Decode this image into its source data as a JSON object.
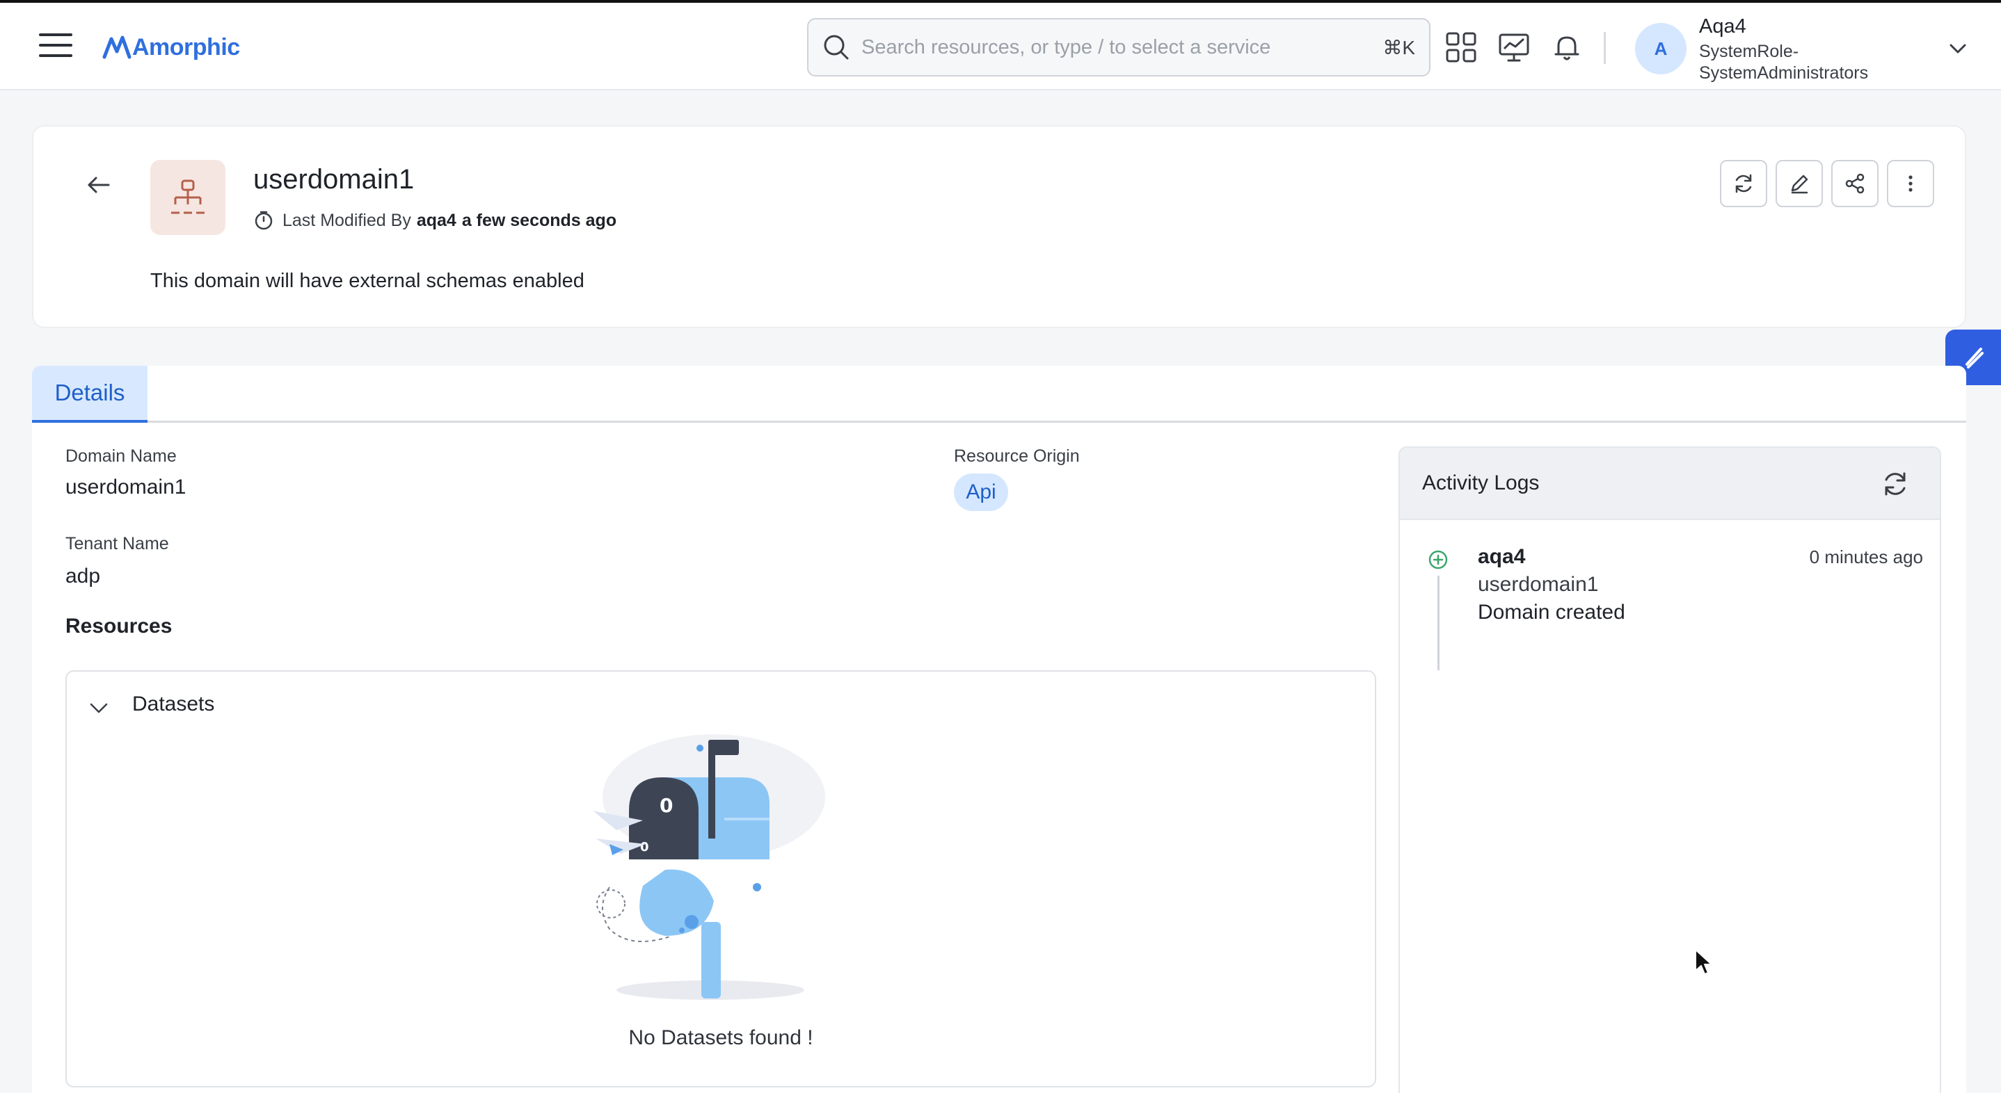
{
  "header": {
    "app_name": "Amorphic",
    "search_placeholder": "Search resources, or type / to select a service",
    "search_shortcut": "⌘K",
    "icons": [
      "menu-icon",
      "apps-grid-icon",
      "dashboard-chart-icon",
      "bell-icon"
    ],
    "user": {
      "avatar_initial": "A",
      "name": "Aqa4",
      "role": "SystemRole-SystemAdministrators"
    }
  },
  "domain": {
    "title": "userdomain1",
    "modified_prefix": "Last Modified By",
    "modified_by": "aqa4",
    "modified_when": "a few seconds ago",
    "description": "This domain will have external schemas enabled",
    "actions": [
      "refresh-icon",
      "edit-icon",
      "share-icon",
      "more-vertical-icon"
    ]
  },
  "tabs": [
    {
      "label": "Details",
      "active": true
    }
  ],
  "details": {
    "domain_name_label": "Domain Name",
    "domain_name_value": "userdomain1",
    "tenant_name_label": "Tenant Name",
    "tenant_name_value": "adp",
    "resource_origin_label": "Resource Origin",
    "resource_origin_value": "Api",
    "resources_title": "Resources",
    "datasets_title": "Datasets",
    "datasets_empty": "No Datasets found !"
  },
  "activity_logs": {
    "title": "Activity Logs",
    "entries": [
      {
        "user": "aqa4",
        "time": "0 minutes ago",
        "entity": "userdomain1",
        "action": "Domain created"
      }
    ]
  },
  "colors": {
    "accent": "#2f6fde",
    "tab_bg": "#d8e9ff",
    "badge_bg": "#d4e7ff",
    "fab": "#2f5fe0",
    "domain_icon_bg": "#f6e6e2",
    "log_dot": "#3aa66b"
  }
}
